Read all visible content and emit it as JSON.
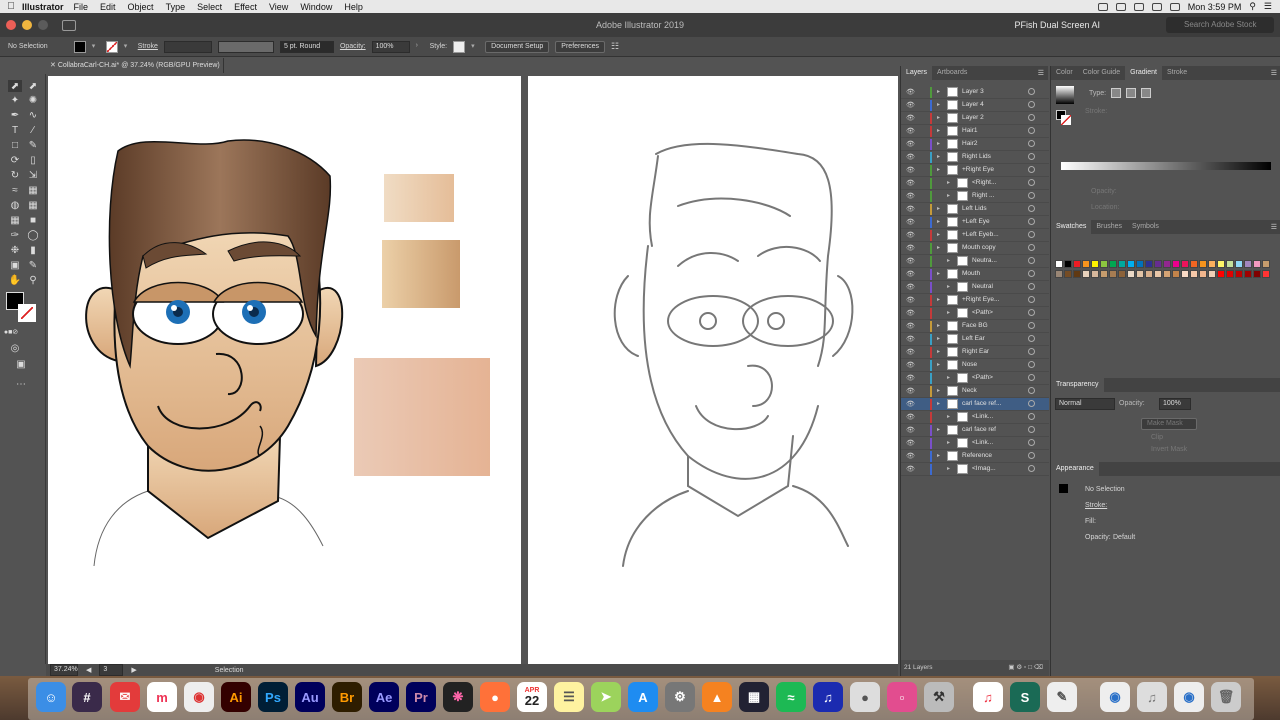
{
  "menubar": {
    "app": "Illustrator",
    "items": [
      "File",
      "Edit",
      "Object",
      "Type",
      "Select",
      "Effect",
      "View",
      "Window",
      "Help"
    ],
    "clock": "Mon 3:59 PM"
  },
  "titlebar": {
    "title": "Adobe Illustrator 2019",
    "workspace": "PFish Dual Screen AI",
    "search_placeholder": "Search Adobe Stock"
  },
  "controlbar": {
    "selection": "No Selection",
    "stroke_label": "Stroke",
    "brush": "5 pt. Round",
    "opacity_label": "Opacity:",
    "opacity_value": "100%",
    "style_label": "Style:",
    "doc_setup": "Document Setup",
    "preferences": "Preferences"
  },
  "document": {
    "tab": "CollabraCarl-CH.ai* @ 37.24% (RGB/GPU Preview)"
  },
  "statusbar": {
    "zoom": "37.24%",
    "artboard": "3",
    "tool": "Selection"
  },
  "layers_panel": {
    "tabs": [
      "Layers",
      "Artboards"
    ],
    "rows": [
      {
        "label": "Layer 3",
        "color": "#4f9a3c",
        "depth": 0
      },
      {
        "label": "Layer 4",
        "color": "#3c6ad1",
        "depth": 0
      },
      {
        "label": "Layer 2",
        "color": "#c53a3a",
        "depth": 0
      },
      {
        "label": "Hair1",
        "color": "#c53a3a",
        "depth": 0
      },
      {
        "label": "Hair2",
        "color": "#7a4fc9",
        "depth": 0
      },
      {
        "label": "Right Lids",
        "color": "#3aa0c5",
        "depth": 0
      },
      {
        "label": "+Right Eye",
        "color": "#4f9a3c",
        "depth": 0
      },
      {
        "label": "<Right...",
        "color": "#4f9a3c",
        "depth": 1
      },
      {
        "label": "Right ...",
        "color": "#4f9a3c",
        "depth": 1
      },
      {
        "label": "Left Lids",
        "color": "#c59a3a",
        "depth": 0
      },
      {
        "label": "+Left Eye",
        "color": "#3c6ad1",
        "depth": 0
      },
      {
        "label": "+Left Eyeb...",
        "color": "#c53a3a",
        "depth": 0
      },
      {
        "label": "Mouth copy",
        "color": "#4f9a3c",
        "depth": 0
      },
      {
        "label": "Neutra...",
        "color": "#4f9a3c",
        "depth": 1
      },
      {
        "label": "Mouth",
        "color": "#7a4fc9",
        "depth": 0
      },
      {
        "label": "Neutral",
        "color": "#7a4fc9",
        "depth": 1
      },
      {
        "label": "+Right Eye...",
        "color": "#c53a3a",
        "depth": 0
      },
      {
        "label": "<Path>",
        "color": "#c53a3a",
        "depth": 1
      },
      {
        "label": "Face BG",
        "color": "#c59a3a",
        "depth": 0
      },
      {
        "label": "Left Ear",
        "color": "#3aa0c5",
        "depth": 0
      },
      {
        "label": "Right Ear",
        "color": "#c53a3a",
        "depth": 0
      },
      {
        "label": "Nose",
        "color": "#3aa0c5",
        "depth": 0
      },
      {
        "label": "<Path>",
        "color": "#3aa0c5",
        "depth": 1
      },
      {
        "label": "Neck",
        "color": "#c59a3a",
        "depth": 0
      },
      {
        "label": "carl face ref...",
        "color": "#c53a3a",
        "depth": 0
      },
      {
        "label": "<Link...",
        "color": "#c53a3a",
        "depth": 1
      },
      {
        "label": "carl face ref",
        "color": "#7a4fc9",
        "depth": 0
      },
      {
        "label": "<Link...",
        "color": "#7a4fc9",
        "depth": 1
      },
      {
        "label": "Reference",
        "color": "#3c6ad1",
        "depth": 0
      },
      {
        "label": "<Imag...",
        "color": "#3c6ad1",
        "depth": 1
      }
    ],
    "footer": "21 Layers"
  },
  "color_panel": {
    "tabs": [
      "Color",
      "Color Guide",
      "Gradient",
      "Stroke"
    ],
    "type_label": "Type:",
    "stroke_label": "Stroke:",
    "opacity_label": "Opacity:",
    "location_label": "Location:"
  },
  "swatches_panel": {
    "tabs": [
      "Swatches",
      "Brushes",
      "Symbols"
    ]
  },
  "transparency_panel": {
    "title": "Transparency",
    "blend_mode": "Normal",
    "opacity_label": "Opacity:",
    "opacity_value": "100%",
    "make_mask": "Make Mask",
    "clip": "Clip",
    "invert_mask": "Invert Mask"
  },
  "appearance_panel": {
    "title": "Appearance",
    "selection": "No Selection",
    "stroke": "Stroke:",
    "fill": "Fill:",
    "opacity": "Opacity:",
    "opacity_value": "Default"
  },
  "dock": {
    "date_month": "APR",
    "date_day": "22"
  },
  "colors": {
    "skin_light": "#f1d7b5",
    "skin_dark": "#d8a77a",
    "hair": "#6b4a34",
    "accent_select": "#3f5d84"
  }
}
